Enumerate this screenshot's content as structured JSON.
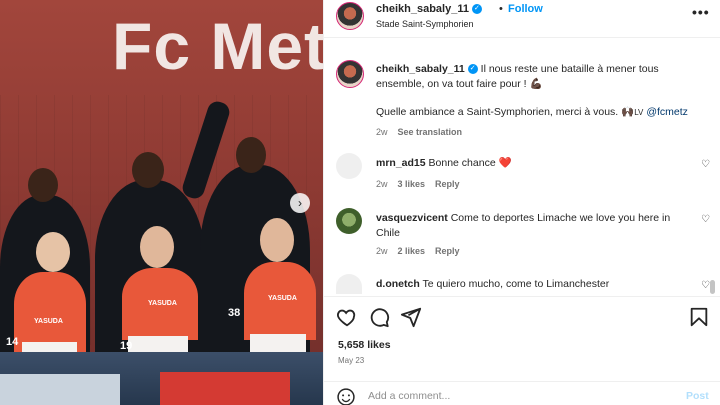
{
  "post_header": {
    "username": "cheikh_sabaly_11",
    "dot": "•",
    "follow_label": "Follow",
    "location": "Stade Saint-Symphorien",
    "more_label": "•••"
  },
  "photo": {
    "banner_text": "Fc Met",
    "sponsor": "YASUDA",
    "numbers": [
      "14",
      "19",
      "38"
    ]
  },
  "caption": {
    "username": "cheikh_sabaly_11",
    "text": "Il nous reste une bataille à mener tous ensemble, on va tout faire pour ! 💪🏿",
    "line2": "Quelle ambiance a Saint-Symphorien, merci à vous.",
    "line2_emoji": "🙌🏿",
    "line2_mid": "LV",
    "mention": "@fcmetz",
    "time": "2w",
    "see_translation": "See translation"
  },
  "comments": [
    {
      "username": "mrn_ad15",
      "text": "Bonne chance",
      "emoji": "❤️",
      "time": "2w",
      "likes": "3 likes",
      "reply": "Reply"
    },
    {
      "username": "vasquezvicent",
      "text": "Come to deportes Limache we love you here in Chile",
      "time": "2w",
      "likes": "2 likes",
      "reply": "Reply"
    },
    {
      "username": "d.onetch",
      "text": "Te quiero mucho, come to Limanchester"
    }
  ],
  "stats": {
    "likes": "5,658 likes",
    "date": "May 23"
  },
  "add_comment": {
    "placeholder": "Add a comment...",
    "post_label": "Post"
  },
  "colors": {
    "accent": "#0095f6",
    "photo_bg": "#8e3a33",
    "kit": "#e8583a"
  },
  "icons": [
    "verified-icon",
    "more-icon",
    "heart-icon",
    "comment-icon",
    "share-icon",
    "bookmark-icon",
    "emoji-icon",
    "next-arrow-icon"
  ]
}
